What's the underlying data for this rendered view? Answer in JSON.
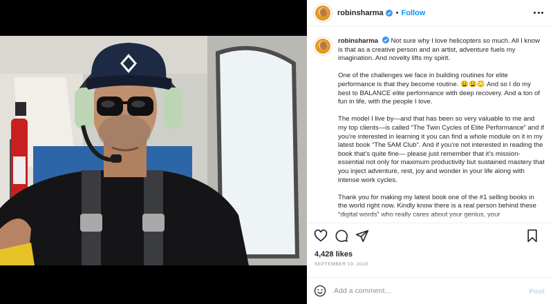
{
  "post": {
    "username": "robinsharma",
    "follow_label": "Follow",
    "separator": "•",
    "caption_paragraphs": [
      "Not sure why I love helicopters so much. All I know is that as a creative person and an artist, adventure fuels my imagination. And novelty lifts my spirit.",
      "One of the challenges we face in building routines for elite performance is that they become routine. 😩😩😳 And so I do my best to BALANCE elite performance with deep recovery. And a ton of fun in life, with the people I love.",
      "The model I live by—and that has been so very valuable to me and my top clients—is called “The Twin Cycles of Elite Performance” and if you’re interested in learning it you can find a whole module on it in my latest book “The 5AM Club”. And if you’re not interested in reading the book that’s quite fine— please just remember that it’s mission-essential not only for maximum productivity but sustained mastery that you inject adventure, rest, joy and wonder in your life along with intense work cycles.",
      "Thank you for making my latest book one of the #1 selling books in the world right now. Kindly know there is a real person behind these “digital words” who really cares about your genius, your"
    ],
    "likes": "4,428 likes",
    "date": "SEPTEMBER 19, 2019"
  },
  "comment": {
    "placeholder": "Add a comment...",
    "post_label": "Post"
  },
  "icons": {
    "header_more": "more-options-icon",
    "like": "heart-icon",
    "comment": "comment-icon",
    "share": "share-icon",
    "save": "bookmark-icon",
    "emoji": "emoji-icon",
    "verified": "verified-badge-icon"
  },
  "colors": {
    "accent": "#0095f6",
    "post_disabled": "#b2dffc",
    "muted": "#8e8e8e",
    "text": "#262626"
  }
}
